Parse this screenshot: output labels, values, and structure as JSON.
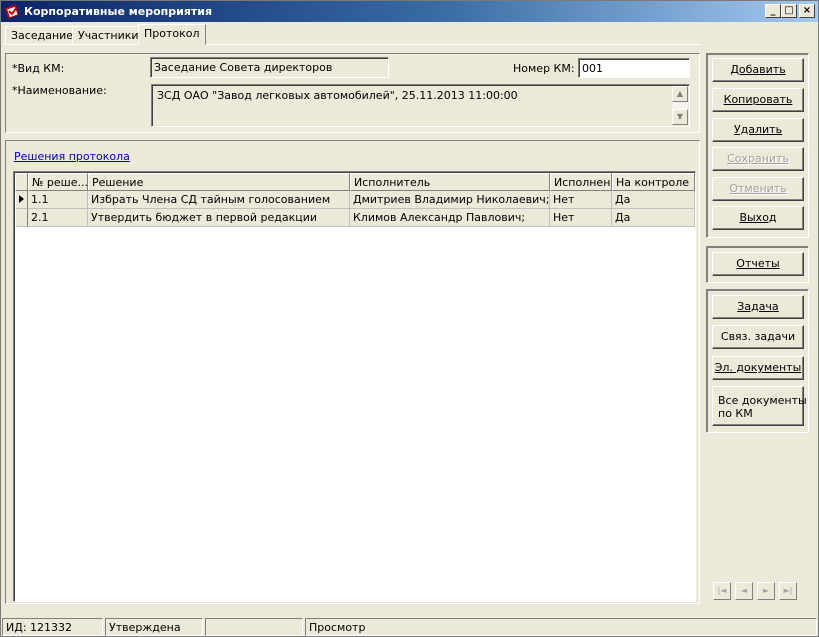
{
  "window": {
    "title": "Корпоративные мероприятия",
    "min_label": "_",
    "max_label": "□",
    "close_label": "×",
    "icon": "app-logo-icon"
  },
  "tabs": [
    {
      "label": "Заседание",
      "active": false
    },
    {
      "label": "Участники",
      "active": false
    },
    {
      "label": "Протокол",
      "active": true
    }
  ],
  "form": {
    "type_label": "*Вид КМ:",
    "type_value": "Заседание Совета директоров",
    "number_label": "Номер КМ:",
    "number_value": "001",
    "name_label": "*Наименование:",
    "name_value": "ЗСД ОАО \"Завод легковых автомобилей\", 25.11.2013 11:00:00"
  },
  "grid": {
    "link": "Решения протокола",
    "columns": [
      "№ реше...",
      "Решение",
      "Исполнитель",
      "Исполнено",
      "На контроле"
    ],
    "rows": [
      {
        "num": "1.1",
        "decision": "Избрать Члена СД тайным голосованием",
        "executor": "Дмитриев Владимир Николаевич;",
        "done": "Нет",
        "control": "Да"
      },
      {
        "num": "2.1",
        "decision": "Утвердить бюджет в первой редакции",
        "executor": "Климов Александр Павлович;",
        "done": "Нет",
        "control": "Да"
      }
    ]
  },
  "buttons": {
    "add": "Добавить",
    "copy": "Копировать",
    "delete": "Удалить",
    "save": "Сохранить",
    "cancel": "Отменить",
    "exit": "Выход",
    "reports": "Отчеты",
    "task": "Задача",
    "linked_tasks": "Связ. задачи",
    "el_docs": "Эл. документы",
    "all_docs_1": "Все документы",
    "all_docs_2": "по КМ"
  },
  "nav": {
    "first": "|◄",
    "prev": "◄",
    "next": "►",
    "last": "►|"
  },
  "status": {
    "id": "ИД: 121332",
    "state": "Утверждена",
    "empty": "",
    "mode": "Просмотр"
  }
}
